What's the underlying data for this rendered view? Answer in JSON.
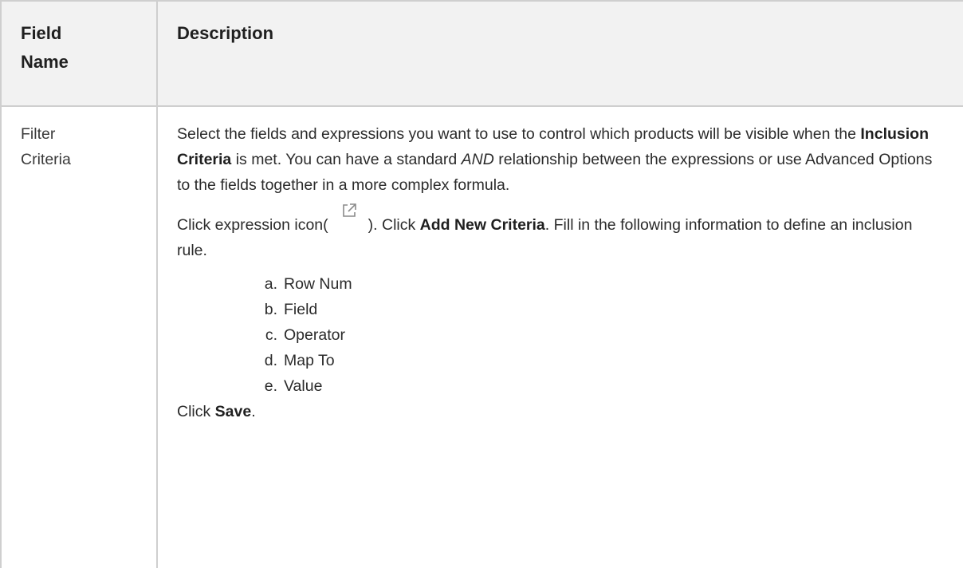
{
  "table": {
    "headers": [
      "Field\nName",
      "Description"
    ],
    "header_field": "Field",
    "header_name": "Name",
    "header_desc": "Description",
    "row": {
      "field_line1": "Filter",
      "field_line2": "Criteria",
      "p1": {
        "t1": "Select the fields and expressions you want to use to control which products will be visible when the ",
        "b1": "Inclusion Criteria",
        "t2": " is met. You can have a standard ",
        "i1": "AND",
        "t3": " relationship between the expressions or use Advanced Options to the fields together in a more complex formula."
      },
      "p2": {
        "t1": "Click expression icon(",
        "icon": "external-link-icon",
        "t2": "). Click ",
        "b1": "Add New Criteria",
        "t3": ". Fill in the following information to define an inclusion rule."
      },
      "steps": [
        {
          "letter": "a.",
          "label": "Row Num"
        },
        {
          "letter": "b.",
          "label": "Field"
        },
        {
          "letter": "c.",
          "label": "Operator"
        },
        {
          "letter": "d.",
          "label": "Map To"
        },
        {
          "letter": "e.",
          "label": "Value"
        }
      ],
      "p3": {
        "t1": "Click ",
        "b1": "Save",
        "t2": "."
      }
    }
  },
  "colors": {
    "border": "#cfcfcf",
    "header_bg": "#f2f2f2",
    "text": "#2b2b2b"
  }
}
